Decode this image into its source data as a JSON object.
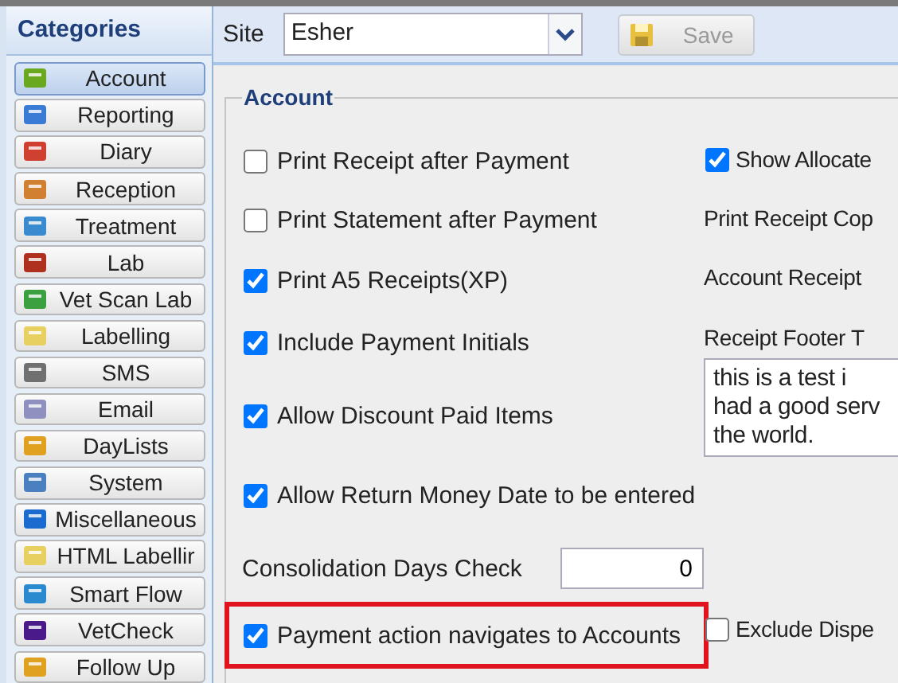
{
  "sidebar": {
    "title": "Categories",
    "items": [
      {
        "label": "Account",
        "selected": true
      },
      {
        "label": "Reporting",
        "selected": false
      },
      {
        "label": "Diary",
        "selected": false
      },
      {
        "label": "Reception",
        "selected": false
      },
      {
        "label": "Treatment",
        "selected": false
      },
      {
        "label": "Lab",
        "selected": false
      },
      {
        "label": "Vet Scan Lab",
        "selected": false
      },
      {
        "label": "Labelling",
        "selected": false
      },
      {
        "label": "SMS",
        "selected": false
      },
      {
        "label": "Email",
        "selected": false
      },
      {
        "label": "DayLists",
        "selected": false
      },
      {
        "label": "System",
        "selected": false
      },
      {
        "label": "Miscellaneous",
        "selected": false
      },
      {
        "label": "HTML Labellir",
        "selected": false
      },
      {
        "label": "Smart Flow",
        "selected": false
      },
      {
        "label": "VetCheck",
        "selected": false
      },
      {
        "label": "Follow Up",
        "selected": false
      }
    ]
  },
  "toolbar": {
    "site_label": "Site",
    "site_value": "Esher",
    "save_button": {
      "label": "Save",
      "disabled": true
    }
  },
  "account": {
    "legend": "Account",
    "rows": [
      {
        "left": {
          "kind": "checkbox",
          "label": "Print Receipt after Payment",
          "checked": false
        },
        "right": {
          "kind": "checkbox",
          "label": "Show Allocate",
          "checked": true
        }
      },
      {
        "left": {
          "kind": "checkbox",
          "label": "Print Statement after Payment",
          "checked": false
        },
        "right": {
          "kind": "label",
          "label": "Print Receipt Cop"
        }
      },
      {
        "left": {
          "kind": "checkbox",
          "label": "Print A5 Receipts(XP)",
          "checked": true
        },
        "right": {
          "kind": "label",
          "label": "Account Receipt"
        }
      },
      {
        "left": {
          "kind": "checkbox",
          "label": "Include Payment Initials",
          "checked": true
        },
        "right": {
          "kind": "label",
          "label": "Receipt Footer T"
        }
      },
      {
        "left": {
          "kind": "checkbox",
          "label": "Allow Discount Paid Items",
          "checked": true
        },
        "right": {
          "kind": "textarea",
          "lines": [
            "this is a test i",
            "had a good serv",
            "the world."
          ]
        }
      },
      {
        "left": {
          "kind": "checkbox",
          "label": "Allow Return Money Date to be entered",
          "checked": true
        }
      },
      {
        "left": {
          "kind": "number",
          "label": "Consolidation Days Check",
          "value": "0"
        }
      },
      {
        "left": {
          "kind": "checkbox",
          "label": "Payment action navigates to Accounts",
          "checked": true,
          "highlighted": true
        },
        "right": {
          "kind": "checkbox",
          "label": "Exclude Dispe",
          "checked": false
        }
      }
    ]
  }
}
